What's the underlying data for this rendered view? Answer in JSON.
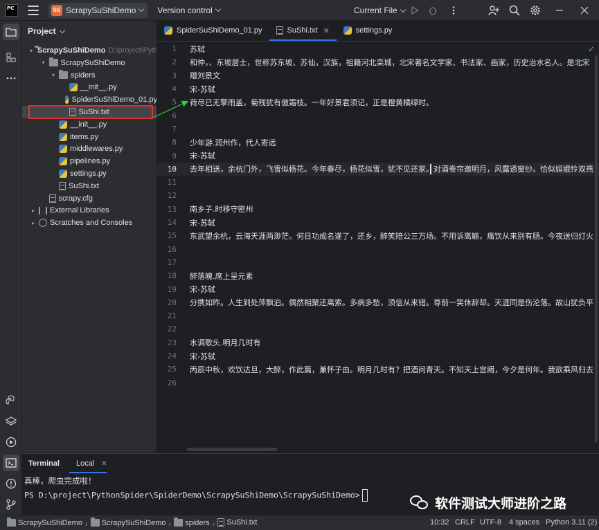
{
  "titlebar": {
    "app_logo": "PC",
    "project_badge": "SS",
    "project_name": "ScrapySuShiDemo",
    "version_control": "Version control",
    "run_config": "Current File",
    "icons": [
      "hamburger-menu-icon",
      "run-icon",
      "debug-icon",
      "add-user-icon",
      "search-icon",
      "settings-gear-icon",
      "minimize-icon",
      "maximize-icon",
      "close-icon"
    ]
  },
  "project_panel": {
    "title": "Project",
    "tree": [
      {
        "label": "ScrapySuShiDemo",
        "suffix": "D:\\project\\Pyth",
        "icon": "folder",
        "depth": 0,
        "expanded": true,
        "bold": true
      },
      {
        "label": "ScrapySuShiDemo",
        "icon": "folder",
        "depth": 1,
        "expanded": true
      },
      {
        "label": "spiders",
        "icon": "folder",
        "depth": 2,
        "expanded": true
      },
      {
        "label": "__init__.py",
        "icon": "py",
        "depth": 3
      },
      {
        "label": "SpiderSuShiDemo_01.py",
        "icon": "py",
        "depth": 3
      },
      {
        "label": "SuShi.txt",
        "icon": "txt",
        "depth": 3,
        "selected": true
      },
      {
        "label": "__init__.py",
        "icon": "py",
        "depth": 2
      },
      {
        "label": "items.py",
        "icon": "py",
        "depth": 2
      },
      {
        "label": "middlewares.py",
        "icon": "py",
        "depth": 2
      },
      {
        "label": "pipelines.py",
        "icon": "py",
        "depth": 2
      },
      {
        "label": "settings.py",
        "icon": "py",
        "depth": 2
      },
      {
        "label": "SuShi.txt",
        "icon": "txt",
        "depth": 2
      },
      {
        "label": "scrapy.cfg",
        "icon": "txt",
        "depth": 1
      },
      {
        "label": "External Libraries",
        "icon": "lib",
        "depth": 0,
        "expanded": false
      },
      {
        "label": "Scratches and Consoles",
        "icon": "scratch",
        "depth": 0,
        "expanded": false
      }
    ]
  },
  "editor": {
    "tabs": [
      {
        "label": "SpiderSuShiDemo_01.py",
        "icon": "py",
        "active": false
      },
      {
        "label": "SuShi.txt",
        "icon": "txt",
        "active": true,
        "closable": true
      },
      {
        "label": "settings.py",
        "icon": "py",
        "active": false
      }
    ],
    "current_line": 10,
    "lines": [
      "苏轼",
      "和仲，、东坡居士，世称苏东坡、苏仙，汉族，祖籍河北栾城，北宋著名文学家、书法家、画家，历史治水名人。是北宋",
      "赠刘景文",
      "宋-苏轼",
      "荷尽已无擎雨盖，菊残犹有傲霜枝。一年好景君须记，正是橙黄橘绿时。",
      "",
      "",
      "少年游.润州作，代人寄远",
      "宋-苏轼",
      "去年相送，余杭门外，飞雪似杨花。今年春尽，杨花似雪，犹不见还家。对酒卷帘邀明月，风露透窗纱。恰似姮娥怜双燕",
      "",
      "",
      "南乡子.时移守密州",
      "宋-苏轼",
      "东武望余杭，云海天涯两渺茫。何日功成名遂了，还乡，醉笑陪公三万场。不用诉离觞，痛饮从来别有肠。今夜送归灯火",
      "",
      "",
      "醉落魄.席上呈元素",
      "宋-苏轼",
      "分携如昨。人生到处萍飘泊。偶然相聚还离索。多病多愁，须信从来错。尊前一笑休辞却。天涯同是伤沦落。故山犹负平",
      "",
      "",
      "水调歌头.明月几时有",
      "宋-苏轼",
      "丙辰中秋，欢饮达旦，大醉，作此篇，兼怀子由。明月几时有？把酒问青天。不知天上宫阙，今夕是何年。我欲乘风归去",
      ""
    ]
  },
  "terminal": {
    "tab_title": "Terminal",
    "session": "Local",
    "output": "真棒，爬虫完成啦！",
    "prompt": "PS D:\\project\\PythonSpider\\SpiderDemo\\ScrapySuShiDemo\\ScrapySuShiDemo>"
  },
  "watermark": {
    "text": "软件测试大师进阶之路",
    "icon": "wechat-icon"
  },
  "statusbar": {
    "breadcrumbs": [
      "ScrapySuShiDemo",
      "ScrapySuShiDemo",
      "spiders",
      "SuShi.txt"
    ],
    "position": "10:32",
    "line_ending": "CRLF",
    "encoding": "UTF-8",
    "indent": "4 spaces",
    "interpreter": "Python 3.11 (2)"
  },
  "colors": {
    "accent": "#3574f0",
    "highlight_box": "#e03131",
    "annotation_arrow": "#2ecc40",
    "project_badge": "#e06c3c"
  }
}
